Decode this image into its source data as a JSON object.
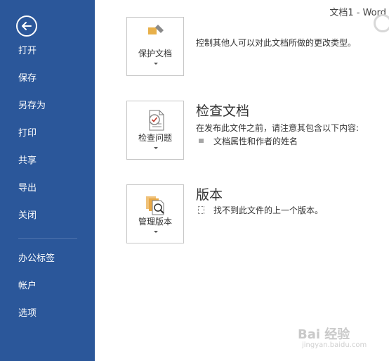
{
  "window": {
    "title": "文档1 - Word"
  },
  "sidebar": {
    "items": [
      {
        "label": "打开"
      },
      {
        "label": "保存"
      },
      {
        "label": "另存为"
      },
      {
        "label": "打印"
      },
      {
        "label": "共享"
      },
      {
        "label": "导出"
      },
      {
        "label": "关闭"
      },
      {
        "label": "办公标签"
      },
      {
        "label": "帐户"
      },
      {
        "label": "选项"
      }
    ]
  },
  "main": {
    "protect": {
      "tile_label": "保护文档",
      "desc": "控制其他人可以对此文档所做的更改类型。"
    },
    "inspect": {
      "tile_label": "检查问题",
      "title": "检查文档",
      "desc": "在发布此文件之前，请注意其包含以下内容:",
      "items": [
        "文档属性和作者的姓名"
      ]
    },
    "versions": {
      "tile_label": "管理版本",
      "title": "版本",
      "desc": "找不到此文件的上一个版本。"
    }
  },
  "watermark": {
    "brand": "Bai 经验",
    "url": "jingyan.baidu.com"
  },
  "colors": {
    "sidebar_bg": "#2b579a",
    "accent_text": "#ffffff"
  }
}
